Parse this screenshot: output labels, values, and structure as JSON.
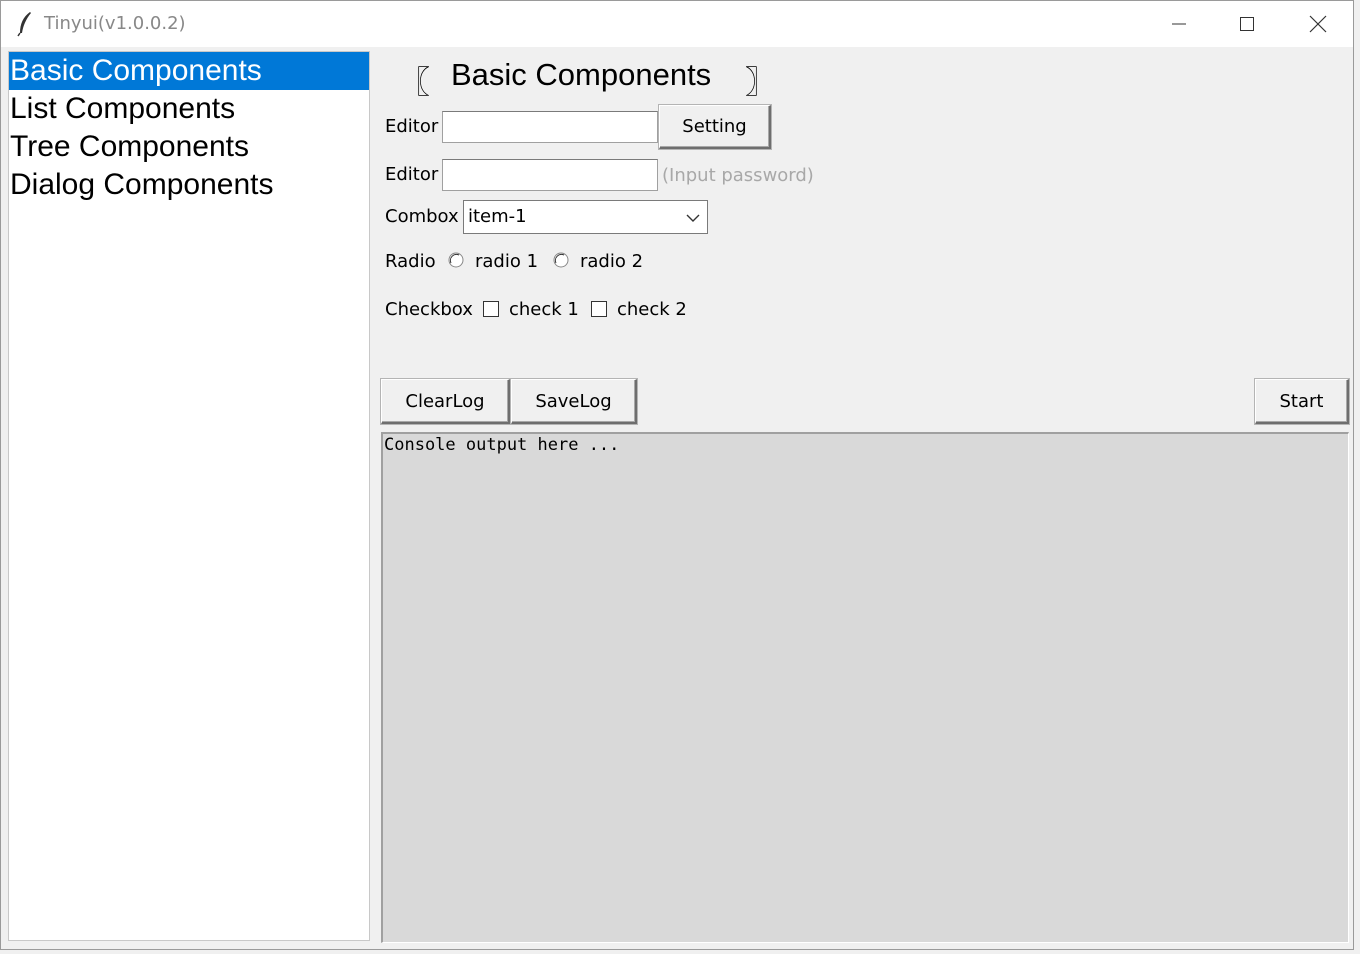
{
  "window": {
    "title": "Tinyui(v1.0.0.2)",
    "icon": "feather-icon"
  },
  "sidebar": {
    "items": [
      {
        "label": "Basic Components",
        "selected": true
      },
      {
        "label": "List Components",
        "selected": false
      },
      {
        "label": "Tree Components",
        "selected": false
      },
      {
        "label": "Dialog Components",
        "selected": false
      }
    ]
  },
  "header": {
    "bracket_left": "〖",
    "title": "Basic Components",
    "bracket_right": "〗"
  },
  "form": {
    "editor1": {
      "label": "Editor",
      "value": "",
      "button_label": "Setting"
    },
    "editor2": {
      "label": "Editor",
      "value": "",
      "hint": "(Input password)"
    },
    "combo": {
      "label": "Combox",
      "value": "item-1"
    },
    "radio": {
      "label": "Radio",
      "options": [
        "radio 1",
        "radio 2"
      ]
    },
    "checkbox": {
      "label": "Checkbox",
      "options": [
        "check 1",
        "check 2"
      ]
    }
  },
  "toolbar": {
    "clear_label": "ClearLog",
    "save_label": "SaveLog",
    "start_label": "Start"
  },
  "console": {
    "text": "Console output here ..."
  },
  "colors": {
    "selection": "#0078d7",
    "console_bg": "#d9d9d9",
    "window_bg": "#f0f0f0"
  }
}
